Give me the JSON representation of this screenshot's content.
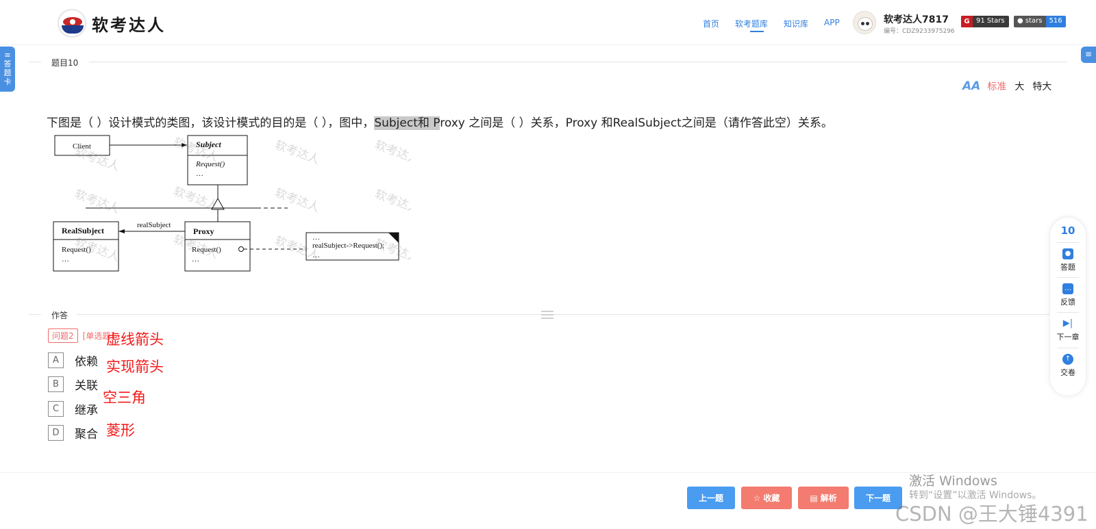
{
  "header": {
    "logo_text": "软考达人",
    "nav": [
      {
        "label": "首页",
        "active": false
      },
      {
        "label": "软考题库",
        "active": true
      },
      {
        "label": "知识库",
        "active": false
      },
      {
        "label": "APP",
        "active": false
      }
    ],
    "user_name": "软考达人7817",
    "user_id": "编号：CDZ9233975296",
    "gitee_badge": "91 Stars",
    "github_label": "stars",
    "github_count": "516"
  },
  "sidebar_left_label": "答题卡",
  "section_question": "题目10",
  "font_sizes": {
    "standard": "标准",
    "large": "大",
    "xlarge": "特大"
  },
  "question": {
    "text_before": "下图是（ ）设计模式的类图，该设计模式的目的是（ ），图中，",
    "highlight": "Subject和 P",
    "text_after": "roxy 之间是（ ）关系，Proxy 和RealSubject之间是（请作答此空）关系。"
  },
  "uml": {
    "client": "Client",
    "subject": "Subject",
    "subject_method": "Request()",
    "ellipsis": "…",
    "real_subject": "RealSubject",
    "real_subject_method": "Request()",
    "proxy": "Proxy",
    "proxy_method": "Request()",
    "assoc_label": "realSubject",
    "note_code": "realSubject->Request();",
    "watermark": "软考达人"
  },
  "section_answer": "作答",
  "answer": {
    "tag": "问题2",
    "type": "[单选题]",
    "options": [
      {
        "letter": "A",
        "text": "依赖"
      },
      {
        "letter": "B",
        "text": "关联"
      },
      {
        "letter": "C",
        "text": "继承"
      },
      {
        "letter": "D",
        "text": "聚合"
      }
    ],
    "annotations": [
      "虚线箭头",
      "实现箭头",
      "空三角",
      "菱形"
    ]
  },
  "float_panel": {
    "number": "10",
    "items": [
      {
        "label": "答题",
        "icon": "answer-icon"
      },
      {
        "label": "反馈",
        "icon": "feedback-icon"
      },
      {
        "label": "下一章",
        "icon": "next-chapter-icon"
      },
      {
        "label": "交卷",
        "icon": "submit-icon"
      }
    ]
  },
  "buttons": {
    "prev": "上一题",
    "favorite": "收藏",
    "analysis": "解析",
    "next": "下一题"
  },
  "watermarks": {
    "activate": "激活 Windows",
    "activate_hint": "转到“设置”以激活 Windows。",
    "csdn": "CSDN @王大锤4391"
  }
}
